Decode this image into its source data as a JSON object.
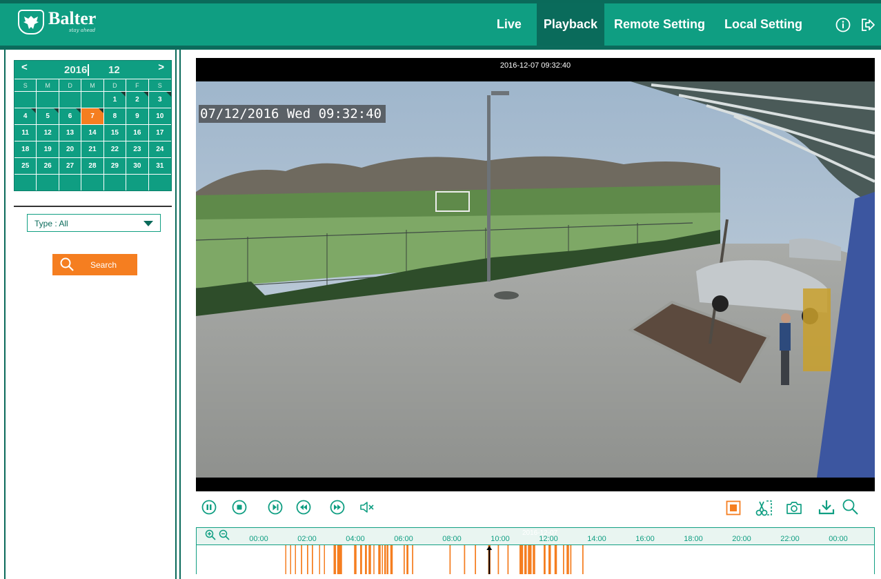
{
  "brand": {
    "name": "Balter",
    "tagline": "stay ahead"
  },
  "nav": {
    "items": [
      {
        "label": "Live",
        "active": false
      },
      {
        "label": "Playback",
        "active": true
      },
      {
        "label": "Remote Setting",
        "active": false
      },
      {
        "label": "Local Setting",
        "active": false
      }
    ],
    "icons": [
      "info-icon",
      "logout-icon"
    ]
  },
  "calendar": {
    "prev": "<",
    "next": ">",
    "year": "2016",
    "month": "12",
    "weekdays": [
      "S",
      "M",
      "D",
      "M",
      "D",
      "F",
      "S"
    ],
    "selected_day": 7,
    "marked_days": [
      1,
      2,
      3,
      4,
      5,
      6,
      7
    ],
    "weeks": [
      [
        "",
        "",
        "",
        "",
        "1",
        "2",
        "3"
      ],
      [
        "4",
        "5",
        "6",
        "7",
        "8",
        "9",
        "10"
      ],
      [
        "11",
        "12",
        "13",
        "14",
        "15",
        "16",
        "17"
      ],
      [
        "18",
        "19",
        "20",
        "21",
        "22",
        "23",
        "24"
      ],
      [
        "25",
        "26",
        "27",
        "28",
        "29",
        "30",
        "31"
      ],
      [
        "",
        "",
        "",
        "",
        "",
        "",
        ""
      ]
    ]
  },
  "filter": {
    "type_label": "Type : All"
  },
  "search": {
    "label": "Search"
  },
  "video": {
    "top_timestamp": "2016-12-07 09:32:40",
    "osd_timestamp": "07/12/2016 Wed 09:32:40"
  },
  "controls": {
    "left": [
      "pause-icon",
      "stop-icon",
      "step-forward-icon",
      "rewind-icon",
      "fast-forward-icon",
      "mute-icon"
    ],
    "right": [
      "record-icon",
      "clip-icon",
      "snapshot-icon",
      "download-icon",
      "zoom-icon"
    ]
  },
  "timeline": {
    "date_label": "2016-12-07",
    "tick_labels": [
      "00:00",
      "02:00",
      "04:00",
      "06:00",
      "08:00",
      "10:00",
      "12:00",
      "14:00",
      "16:00",
      "18:00",
      "20:00",
      "22:00",
      "00:00"
    ],
    "cursor_hour": 9.55,
    "recordings_hours": [
      [
        1.1,
        1.13
      ],
      [
        1.3,
        1.34
      ],
      [
        1.5,
        1.53
      ],
      [
        1.75,
        1.8
      ],
      [
        2.0,
        2.05
      ],
      [
        2.2,
        2.25
      ],
      [
        2.5,
        2.54
      ],
      [
        2.7,
        2.74
      ],
      [
        3.1,
        3.2
      ],
      [
        3.25,
        3.45
      ],
      [
        3.95,
        4.05
      ],
      [
        4.2,
        4.28
      ],
      [
        4.4,
        4.48
      ],
      [
        4.55,
        4.65
      ],
      [
        4.75,
        4.78
      ],
      [
        4.95,
        5.05
      ],
      [
        5.1,
        5.13
      ],
      [
        5.2,
        5.27
      ],
      [
        5.3,
        5.37
      ],
      [
        5.45,
        5.55
      ],
      [
        6.0,
        6.05
      ],
      [
        6.12,
        6.2
      ],
      [
        6.35,
        6.4
      ],
      [
        7.9,
        7.95
      ],
      [
        8.5,
        8.55
      ],
      [
        8.95,
        9.0
      ],
      [
        9.5,
        9.6
      ],
      [
        9.9,
        9.95
      ],
      [
        10.3,
        10.35
      ],
      [
        10.8,
        10.95
      ],
      [
        11.0,
        11.1
      ],
      [
        11.15,
        11.3
      ],
      [
        11.35,
        11.45
      ],
      [
        11.8,
        11.88
      ],
      [
        12.0,
        12.1
      ],
      [
        12.25,
        12.35
      ],
      [
        12.6,
        12.65
      ],
      [
        12.75,
        12.85
      ],
      [
        12.9,
        12.95
      ],
      [
        13.4,
        13.45
      ]
    ]
  }
}
